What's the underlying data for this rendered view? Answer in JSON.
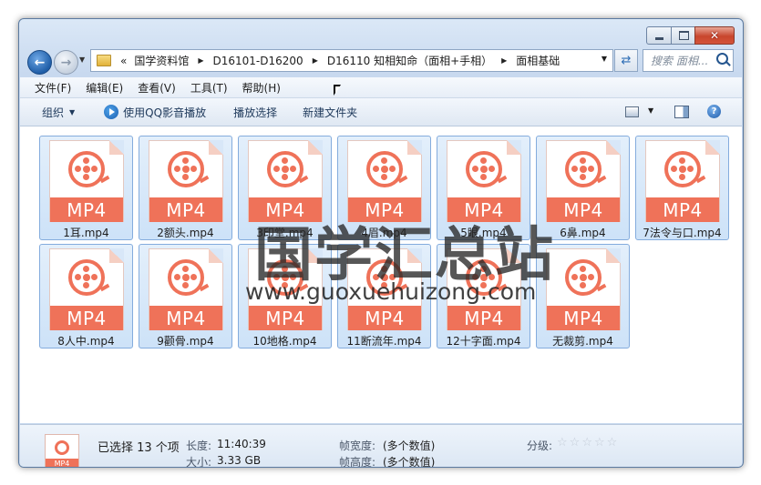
{
  "window": {
    "controls": {
      "minimize": "minimize",
      "maximize": "maximize",
      "close": "✕"
    }
  },
  "address": {
    "lead": "«",
    "crumbs": [
      "国学资料馆",
      "D16101-D16200",
      "D16110 知相知命（面相+手相）",
      "面相基础"
    ]
  },
  "search": {
    "placeholder": "搜索 面相..."
  },
  "menu": [
    "文件(F)",
    "编辑(E)",
    "查看(V)",
    "工具(T)",
    "帮助(H)"
  ],
  "toolbar": {
    "organize": "组织",
    "qq_play": "使用QQ影音播放",
    "play_selection": "播放选择",
    "new_folder": "新建文件夹"
  },
  "files": [
    {
      "name": "1耳.mp4",
      "badge": "MP4"
    },
    {
      "name": "2额头.mp4",
      "badge": "MP4"
    },
    {
      "name": "3印堂.mp4",
      "badge": "MP4"
    },
    {
      "name": "4眉.mp4",
      "badge": "MP4"
    },
    {
      "name": "5眼.mp4",
      "badge": "MP4"
    },
    {
      "name": "6鼻.mp4",
      "badge": "MP4"
    },
    {
      "name": "7法令与口.mp4",
      "badge": "MP4"
    },
    {
      "name": "8人中.mp4",
      "badge": "MP4"
    },
    {
      "name": "9颧骨.mp4",
      "badge": "MP4"
    },
    {
      "name": "10地格.mp4",
      "badge": "MP4"
    },
    {
      "name": "11断流年.mp4",
      "badge": "MP4"
    },
    {
      "name": "12十字面.mp4",
      "badge": "MP4"
    },
    {
      "name": "无裁剪.mp4",
      "badge": "MP4"
    }
  ],
  "watermark": {
    "cn": "国学汇总站",
    "url": "www.guoxuehuizong.com"
  },
  "details": {
    "icon_badge": "MP4",
    "selected": "已选择 13 个项",
    "length_label": "长度:",
    "length_value": "11:40:39",
    "size_label": "大小:",
    "size_value": "3.33 GB",
    "frame_width_label": "帧宽度:",
    "frame_width_value": "(多个数值)",
    "frame_height_label": "帧高度:",
    "frame_height_value": "(多个数值)",
    "rating_label": "分级:",
    "rating_stars": [
      "☆",
      "☆",
      "☆",
      "☆",
      "☆"
    ]
  }
}
